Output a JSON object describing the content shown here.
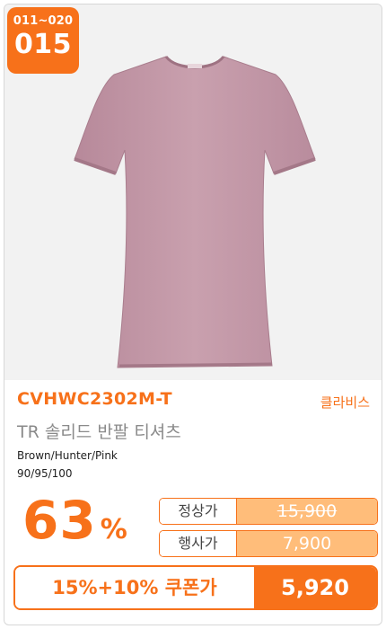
{
  "badge": {
    "range": "011~020",
    "number": "015"
  },
  "product": {
    "code": "CVHWC2302M-T",
    "brand": "클라비스",
    "name": "TR 솔리드 반팔 티셔츠",
    "colors": "Brown/Hunter/Pink",
    "sizes": "90/95/100",
    "image_icon": "t-shirt-icon",
    "image_color": "#c49aa8"
  },
  "discount": {
    "percent": "63",
    "sign": "%"
  },
  "prices": {
    "regular_label": "정상가",
    "regular_value": "15,900",
    "event_label": "행사가",
    "event_value": "7,900"
  },
  "coupon": {
    "label": "15%+10% 쿠폰가",
    "value": "5,920"
  },
  "colors": {
    "accent": "#f7711a",
    "accent_light": "#ffbd7a"
  }
}
